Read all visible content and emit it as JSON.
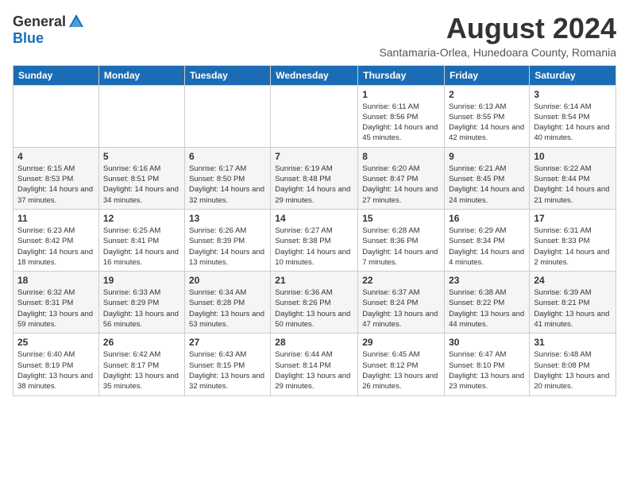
{
  "logo": {
    "general": "General",
    "blue": "Blue"
  },
  "title": "August 2024",
  "subtitle": "Santamaria-Orlea, Hunedoara County, Romania",
  "days_of_week": [
    "Sunday",
    "Monday",
    "Tuesday",
    "Wednesday",
    "Thursday",
    "Friday",
    "Saturday"
  ],
  "weeks": [
    [
      {
        "day": "",
        "info": ""
      },
      {
        "day": "",
        "info": ""
      },
      {
        "day": "",
        "info": ""
      },
      {
        "day": "",
        "info": ""
      },
      {
        "day": "1",
        "info": "Sunrise: 6:11 AM\nSunset: 8:56 PM\nDaylight: 14 hours and 45 minutes."
      },
      {
        "day": "2",
        "info": "Sunrise: 6:13 AM\nSunset: 8:55 PM\nDaylight: 14 hours and 42 minutes."
      },
      {
        "day": "3",
        "info": "Sunrise: 6:14 AM\nSunset: 8:54 PM\nDaylight: 14 hours and 40 minutes."
      }
    ],
    [
      {
        "day": "4",
        "info": "Sunrise: 6:15 AM\nSunset: 8:53 PM\nDaylight: 14 hours and 37 minutes."
      },
      {
        "day": "5",
        "info": "Sunrise: 6:16 AM\nSunset: 8:51 PM\nDaylight: 14 hours and 34 minutes."
      },
      {
        "day": "6",
        "info": "Sunrise: 6:17 AM\nSunset: 8:50 PM\nDaylight: 14 hours and 32 minutes."
      },
      {
        "day": "7",
        "info": "Sunrise: 6:19 AM\nSunset: 8:48 PM\nDaylight: 14 hours and 29 minutes."
      },
      {
        "day": "8",
        "info": "Sunrise: 6:20 AM\nSunset: 8:47 PM\nDaylight: 14 hours and 27 minutes."
      },
      {
        "day": "9",
        "info": "Sunrise: 6:21 AM\nSunset: 8:45 PM\nDaylight: 14 hours and 24 minutes."
      },
      {
        "day": "10",
        "info": "Sunrise: 6:22 AM\nSunset: 8:44 PM\nDaylight: 14 hours and 21 minutes."
      }
    ],
    [
      {
        "day": "11",
        "info": "Sunrise: 6:23 AM\nSunset: 8:42 PM\nDaylight: 14 hours and 18 minutes."
      },
      {
        "day": "12",
        "info": "Sunrise: 6:25 AM\nSunset: 8:41 PM\nDaylight: 14 hours and 16 minutes."
      },
      {
        "day": "13",
        "info": "Sunrise: 6:26 AM\nSunset: 8:39 PM\nDaylight: 14 hours and 13 minutes."
      },
      {
        "day": "14",
        "info": "Sunrise: 6:27 AM\nSunset: 8:38 PM\nDaylight: 14 hours and 10 minutes."
      },
      {
        "day": "15",
        "info": "Sunrise: 6:28 AM\nSunset: 8:36 PM\nDaylight: 14 hours and 7 minutes."
      },
      {
        "day": "16",
        "info": "Sunrise: 6:29 AM\nSunset: 8:34 PM\nDaylight: 14 hours and 4 minutes."
      },
      {
        "day": "17",
        "info": "Sunrise: 6:31 AM\nSunset: 8:33 PM\nDaylight: 14 hours and 2 minutes."
      }
    ],
    [
      {
        "day": "18",
        "info": "Sunrise: 6:32 AM\nSunset: 8:31 PM\nDaylight: 13 hours and 59 minutes."
      },
      {
        "day": "19",
        "info": "Sunrise: 6:33 AM\nSunset: 8:29 PM\nDaylight: 13 hours and 56 minutes."
      },
      {
        "day": "20",
        "info": "Sunrise: 6:34 AM\nSunset: 8:28 PM\nDaylight: 13 hours and 53 minutes."
      },
      {
        "day": "21",
        "info": "Sunrise: 6:36 AM\nSunset: 8:26 PM\nDaylight: 13 hours and 50 minutes."
      },
      {
        "day": "22",
        "info": "Sunrise: 6:37 AM\nSunset: 8:24 PM\nDaylight: 13 hours and 47 minutes."
      },
      {
        "day": "23",
        "info": "Sunrise: 6:38 AM\nSunset: 8:22 PM\nDaylight: 13 hours and 44 minutes."
      },
      {
        "day": "24",
        "info": "Sunrise: 6:39 AM\nSunset: 8:21 PM\nDaylight: 13 hours and 41 minutes."
      }
    ],
    [
      {
        "day": "25",
        "info": "Sunrise: 6:40 AM\nSunset: 8:19 PM\nDaylight: 13 hours and 38 minutes."
      },
      {
        "day": "26",
        "info": "Sunrise: 6:42 AM\nSunset: 8:17 PM\nDaylight: 13 hours and 35 minutes."
      },
      {
        "day": "27",
        "info": "Sunrise: 6:43 AM\nSunset: 8:15 PM\nDaylight: 13 hours and 32 minutes."
      },
      {
        "day": "28",
        "info": "Sunrise: 6:44 AM\nSunset: 8:14 PM\nDaylight: 13 hours and 29 minutes."
      },
      {
        "day": "29",
        "info": "Sunrise: 6:45 AM\nSunset: 8:12 PM\nDaylight: 13 hours and 26 minutes."
      },
      {
        "day": "30",
        "info": "Sunrise: 6:47 AM\nSunset: 8:10 PM\nDaylight: 13 hours and 23 minutes."
      },
      {
        "day": "31",
        "info": "Sunrise: 6:48 AM\nSunset: 8:08 PM\nDaylight: 13 hours and 20 minutes."
      }
    ]
  ]
}
